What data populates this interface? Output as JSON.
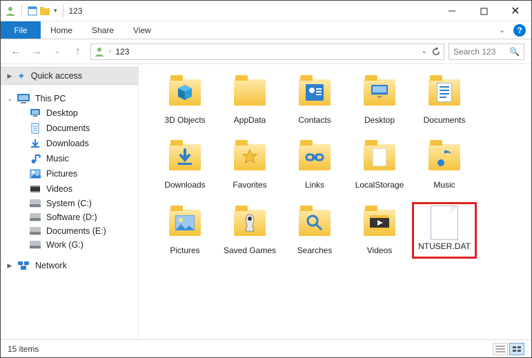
{
  "titlebar": {
    "title": "123"
  },
  "menubar": {
    "file": "File",
    "tabs": [
      "Home",
      "Share",
      "View"
    ]
  },
  "nav": {
    "crumb": "123",
    "search_placeholder": "Search 123"
  },
  "sidebar": {
    "quick_access": "Quick access",
    "this_pc": "This PC",
    "items": [
      {
        "label": "Desktop",
        "icon": "desktop"
      },
      {
        "label": "Documents",
        "icon": "document"
      },
      {
        "label": "Downloads",
        "icon": "download"
      },
      {
        "label": "Music",
        "icon": "music"
      },
      {
        "label": "Pictures",
        "icon": "pictures"
      },
      {
        "label": "Videos",
        "icon": "videos"
      },
      {
        "label": "System (C:)",
        "icon": "drive"
      },
      {
        "label": "Software (D:)",
        "icon": "drive"
      },
      {
        "label": "Documents (E:)",
        "icon": "drive"
      },
      {
        "label": "Work (G:)",
        "icon": "drive"
      }
    ],
    "network": "Network"
  },
  "content": {
    "items": [
      {
        "label": "3D Objects",
        "kind": "folder",
        "glyph": "cube"
      },
      {
        "label": "AppData",
        "kind": "folder",
        "glyph": ""
      },
      {
        "label": "Contacts",
        "kind": "folder",
        "glyph": "contacts"
      },
      {
        "label": "Desktop",
        "kind": "folder",
        "glyph": "desktop"
      },
      {
        "label": "Documents",
        "kind": "folder",
        "glyph": "document"
      },
      {
        "label": "Downloads",
        "kind": "folder",
        "glyph": "download"
      },
      {
        "label": "Favorites",
        "kind": "folder",
        "glyph": "star"
      },
      {
        "label": "Links",
        "kind": "folder",
        "glyph": "link"
      },
      {
        "label": "LocalStorage",
        "kind": "folder",
        "glyph": "page"
      },
      {
        "label": "Music",
        "kind": "folder",
        "glyph": "music"
      },
      {
        "label": "Pictures",
        "kind": "folder",
        "glyph": "picture"
      },
      {
        "label": "Saved Games",
        "kind": "folder",
        "glyph": "game"
      },
      {
        "label": "Searches",
        "kind": "folder",
        "glyph": "search"
      },
      {
        "label": "Videos",
        "kind": "folder",
        "glyph": "video"
      },
      {
        "label": "NTUSER.DAT",
        "kind": "file",
        "highlight": true
      }
    ]
  },
  "status": {
    "count_label": "15 items"
  }
}
